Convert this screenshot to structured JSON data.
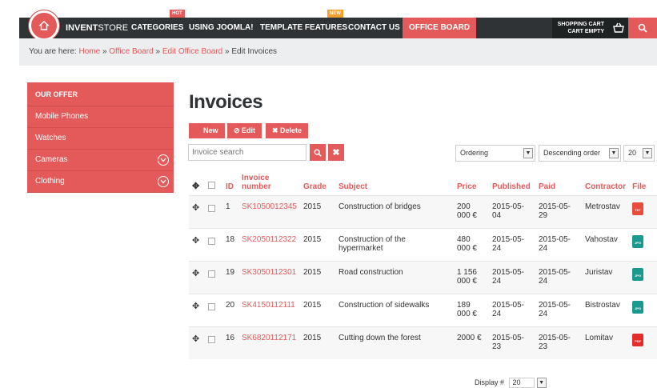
{
  "header": {
    "brand_bold": "INVENT",
    "brand_light": "STORE",
    "nav": [
      {
        "label": "CATEGORIES",
        "badge": "HOT"
      },
      {
        "label": "USING JOOMLA!",
        "badge": ""
      },
      {
        "label": "TEMPLATE FEATURES",
        "badge": "NEW"
      },
      {
        "label": "CONTACT US",
        "badge": ""
      },
      {
        "label": "OFFICE BOARD",
        "badge": ""
      }
    ],
    "cart_title": "SHOPPING CART",
    "cart_status": "CART EMPTY"
  },
  "breadcrumb": {
    "prefix": "You are here:",
    "links": [
      "Home",
      "Office Board",
      "Edit Office Board"
    ],
    "current": "Edit Invoices",
    "sep": "»"
  },
  "sidebar": {
    "title": "OUR OFFER",
    "items": [
      {
        "label": "Mobile Phones"
      },
      {
        "label": "Watches"
      },
      {
        "label": "Cameras"
      },
      {
        "label": "Clothing"
      }
    ]
  },
  "main": {
    "title": "Invoices",
    "toolbar": {
      "new": "New",
      "edit": "Edit",
      "delete": "Delete"
    },
    "search_placeholder": "Invoice search",
    "ordering": "Ordering",
    "direction": "Descending order",
    "limit": "20",
    "columns": [
      "ID",
      "Invoice number",
      "Grade",
      "Subject",
      "Price",
      "Published",
      "Paid",
      "Contractor",
      "File"
    ],
    "rows": [
      {
        "id": "1",
        "number": "SK1050012345",
        "grade": "2015",
        "subject": "Construction of bridges",
        "price": "200 000 €",
        "published": "2015-05-04",
        "paid": "2015-05-29",
        "contractor": "Metrostav",
        "file": "TXT"
      },
      {
        "id": "18",
        "number": "SK2050112322",
        "grade": "2015",
        "subject": "Construction of the hypermarket",
        "price": "480 000 €",
        "published": "2015-05-24",
        "paid": "2015-05-24",
        "contractor": "Vahostav",
        "file": "JPG"
      },
      {
        "id": "19",
        "number": "SK3050112301",
        "grade": "2015",
        "subject": "Road construction",
        "price": "1 156 000 €",
        "published": "2015-05-24",
        "paid": "2015-05-24",
        "contractor": "Juristav",
        "file": "JPG"
      },
      {
        "id": "20",
        "number": "SK4150112111",
        "grade": "2015",
        "subject": "Construction of sidewalks",
        "price": "189 000 €",
        "published": "2015-05-24",
        "paid": "2015-05-24",
        "contractor": "Bistrostav",
        "file": "JPG"
      },
      {
        "id": "16",
        "number": "SK6820112171",
        "grade": "2015",
        "subject": "Cutting down the forest",
        "price": "2000 €",
        "published": "2015-05-23",
        "paid": "2015-05-23",
        "contractor": "Lomitav",
        "file": "PDF"
      }
    ],
    "display_label": "Display #",
    "display_value": "20"
  },
  "colors": {
    "accent": "#e45a5a",
    "nav_bg": "#2f3335",
    "badge_new": "#f0a030"
  }
}
